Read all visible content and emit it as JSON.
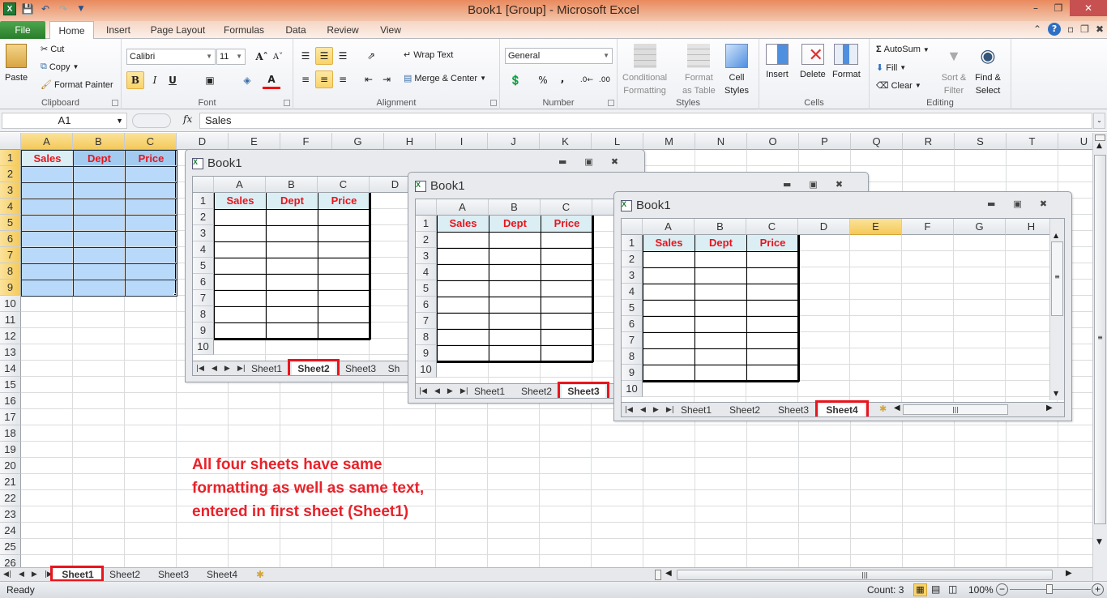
{
  "titlebar": {
    "title": "Book1  [Group]  -  Microsoft Excel",
    "app_icon": "excel-icon",
    "qat": [
      "save-icon",
      "undo-icon",
      "redo-icon",
      "customize-qat-icon"
    ],
    "controls": [
      "minimize",
      "restore",
      "close"
    ]
  },
  "ribbon_tabs": [
    "File",
    "Home",
    "Insert",
    "Page Layout",
    "Formulas",
    "Data",
    "Review",
    "View"
  ],
  "active_tab": "Home",
  "ribbon": {
    "clipboard": {
      "label": "Clipboard",
      "paste": "Paste",
      "cut": "Cut",
      "copy": "Copy",
      "format_painter": "Format Painter"
    },
    "font": {
      "label": "Font",
      "font_name": "Calibri",
      "font_size": "11",
      "bold": "B",
      "italic": "I",
      "underline": "U"
    },
    "alignment": {
      "label": "Alignment",
      "wrap_text": "Wrap Text",
      "merge_center": "Merge & Center"
    },
    "number": {
      "label": "Number",
      "format": "General",
      "percent": "%",
      "comma": ","
    },
    "styles": {
      "label": "Styles",
      "conditional_1": "Conditional",
      "conditional_2": "Formatting",
      "format_table_1": "Format",
      "format_table_2": "as Table",
      "cell_styles_1": "Cell",
      "cell_styles_2": "Styles"
    },
    "cells": {
      "label": "Cells",
      "insert": "Insert",
      "delete": "Delete",
      "format": "Format"
    },
    "editing": {
      "label": "Editing",
      "autosum": "AutoSum",
      "fill": "Fill",
      "clear": "Clear",
      "sort_1": "Sort &",
      "sort_2": "Filter",
      "find_1": "Find &",
      "find_2": "Select"
    }
  },
  "formula_bar": {
    "name_box": "A1",
    "fx": "fx",
    "formula": "Sales"
  },
  "columns": [
    "A",
    "B",
    "C",
    "D",
    "E",
    "F",
    "G",
    "H",
    "I",
    "J",
    "K",
    "L",
    "M",
    "N",
    "O",
    "P",
    "Q",
    "R",
    "S",
    "T",
    "U"
  ],
  "rows": [
    "1",
    "2",
    "3",
    "4",
    "5",
    "6",
    "7",
    "8",
    "9",
    "10",
    "11",
    "12",
    "13",
    "14",
    "15",
    "16",
    "17",
    "18",
    "19",
    "20",
    "21",
    "22",
    "23",
    "24",
    "25",
    "26"
  ],
  "table_headers": [
    "Sales",
    "Dept",
    "Price"
  ],
  "windows": [
    {
      "title": "Book1",
      "columns": [
        "A",
        "B",
        "C",
        "D"
      ],
      "rows": [
        "1",
        "2",
        "3",
        "4",
        "5",
        "6",
        "7",
        "8",
        "9",
        "10"
      ],
      "tabs": [
        "Sheet1",
        "Sheet2",
        "Sheet3",
        "Sh"
      ],
      "active_tab": "Sheet2"
    },
    {
      "title": "Book1",
      "columns": [
        "A",
        "B",
        "C"
      ],
      "rows": [
        "1",
        "2",
        "3",
        "4",
        "5",
        "6",
        "7",
        "8",
        "9",
        "10"
      ],
      "tabs": [
        "Sheet1",
        "Sheet2",
        "Sheet3"
      ],
      "active_tab": "Sheet3"
    },
    {
      "title": "Book1",
      "columns": [
        "A",
        "B",
        "C",
        "D",
        "E",
        "F",
        "G",
        "H"
      ],
      "rows": [
        "1",
        "2",
        "3",
        "4",
        "5",
        "6",
        "7",
        "8",
        "9",
        "10"
      ],
      "tabs": [
        "Sheet1",
        "Sheet2",
        "Sheet3",
        "Sheet4"
      ],
      "active_tab": "Sheet4"
    }
  ],
  "note": "All four sheets have same formatting as well as same text, entered in first sheet (Sheet1)",
  "sheet_tabs": [
    "Sheet1",
    "Sheet2",
    "Sheet3",
    "Sheet4"
  ],
  "active_sheet": "Sheet1",
  "status": {
    "ready": "Ready",
    "count": "Count: 3",
    "zoom": "100%"
  },
  "colors": {
    "highlight_red": "#e8151d",
    "selection_blue": "#b9d9fb",
    "header_fill": "#dbeef4",
    "selected_header": "#f4c95a"
  }
}
